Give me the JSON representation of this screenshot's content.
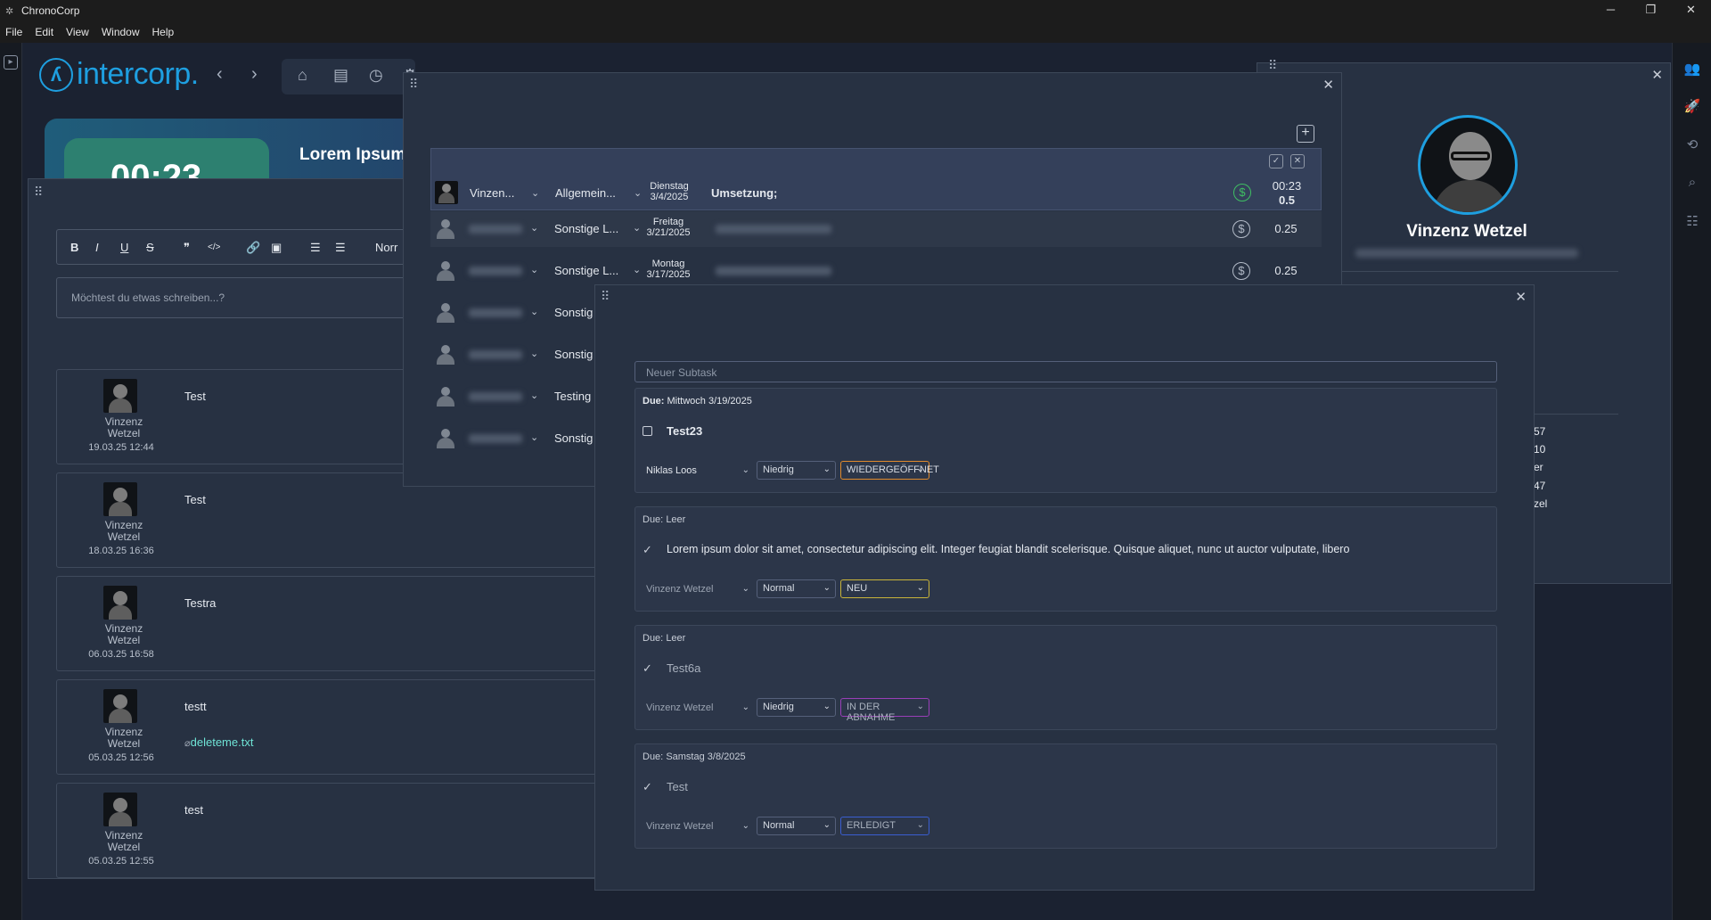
{
  "window": {
    "title": "ChronoCorp",
    "controls": [
      "─",
      "❐",
      "✕"
    ]
  },
  "menu": [
    "File",
    "Edit",
    "View",
    "Window",
    "Help"
  ],
  "brand": {
    "name": "intercorp.",
    "color": "#1e9fe0"
  },
  "hero": {
    "clock": "00:23",
    "title": "Lorem Ipsum"
  },
  "toolbar": {
    "bold": "B",
    "italic": "I",
    "underline": "U",
    "strike": "S",
    "quote": "❞",
    "code": "</>",
    "link": "🔗",
    "image": "▣",
    "ol": "☰",
    "ul": "☰",
    "format": "Norr"
  },
  "compose": {
    "placeholder": "Möchtest du etwas schreiben...?"
  },
  "comments": [
    {
      "first": "Vinzenz",
      "last": "Wetzel",
      "date": "19.03.25 12:44",
      "text": "Test",
      "attachment": ""
    },
    {
      "first": "Vinzenz",
      "last": "Wetzel",
      "date": "18.03.25 16:36",
      "text": "Test",
      "attachment": ""
    },
    {
      "first": "Vinzenz",
      "last": "Wetzel",
      "date": "06.03.25 16:58",
      "text": "Testra",
      "attachment": ""
    },
    {
      "first": "Vinzenz",
      "last": "Wetzel",
      "date": "05.03.25 12:56",
      "text": "testt",
      "attachment": "deleteme.txt"
    },
    {
      "first": "Vinzenz",
      "last": "Wetzel",
      "date": "05.03.25 12:55",
      "text": "test",
      "attachment": ""
    }
  ],
  "profile": {
    "name": "Vinzenz Wetzel",
    "values": [
      "57",
      "10",
      "er",
      "47",
      "zel"
    ]
  },
  "entries": [
    {
      "user": "Vinzen...",
      "type": "Allgemein...",
      "day": "Dienstag",
      "date": "3/4/2025",
      "desc": "Umsetzung;",
      "time": "00:23",
      "hours": "0.5",
      "billable": true
    },
    {
      "user": "",
      "type": "Sonstige L...",
      "day": "Freitag",
      "date": "3/21/2025",
      "desc": "",
      "time": "",
      "hours": "0.25",
      "billable": false
    },
    {
      "user": "",
      "type": "Sonstige L...",
      "day": "Montag",
      "date": "3/17/2025",
      "desc": "",
      "time": "",
      "hours": "0.25",
      "billable": false
    },
    {
      "user": "",
      "type": "Sonstig",
      "day": "",
      "date": "",
      "desc": "",
      "time": "",
      "hours": "",
      "billable": false
    },
    {
      "user": "",
      "type": "Sonstig",
      "day": "",
      "date": "",
      "desc": "",
      "time": "",
      "hours": "",
      "billable": false
    },
    {
      "user": "",
      "type": "Testing",
      "day": "",
      "date": "",
      "desc": "",
      "time": "",
      "hours": "",
      "billable": false
    },
    {
      "user": "",
      "type": "Sonstig",
      "day": "",
      "date": "",
      "desc": "",
      "time": "",
      "hours": "",
      "billable": false
    }
  ],
  "subtasks": {
    "placeholder": "Neuer Subtask",
    "due_label": "Due:",
    "items": [
      {
        "due": "Mittwoch 3/19/2025",
        "title": "Test23",
        "done": false,
        "assignee": "Niklas Loos",
        "priority": "Niedrig",
        "status": "WIEDERGEÖFFNET",
        "status_color": "#e08a2c"
      },
      {
        "due": "Leer",
        "title": "Lorem ipsum dolor sit amet, consectetur adipiscing elit. Integer feugiat blandit scelerisque. Quisque aliquet, nunc ut auctor vulputate, libero",
        "done": true,
        "assignee": "Vinzenz Wetzel",
        "priority": "Normal",
        "status": "NEU",
        "status_color": "#c9b43a"
      },
      {
        "due": "Leer",
        "title": "Test6a",
        "done": true,
        "assignee": "Vinzenz Wetzel",
        "priority": "Niedrig",
        "status": "IN DER ABNAHME",
        "status_color": "#9a3fb8"
      },
      {
        "due": "Samstag 3/8/2025",
        "title": "Test",
        "done": true,
        "assignee": "Vinzenz Wetzel",
        "priority": "Normal",
        "status": "ERLEDIGT",
        "status_color": "#3a5ed0"
      }
    ]
  }
}
